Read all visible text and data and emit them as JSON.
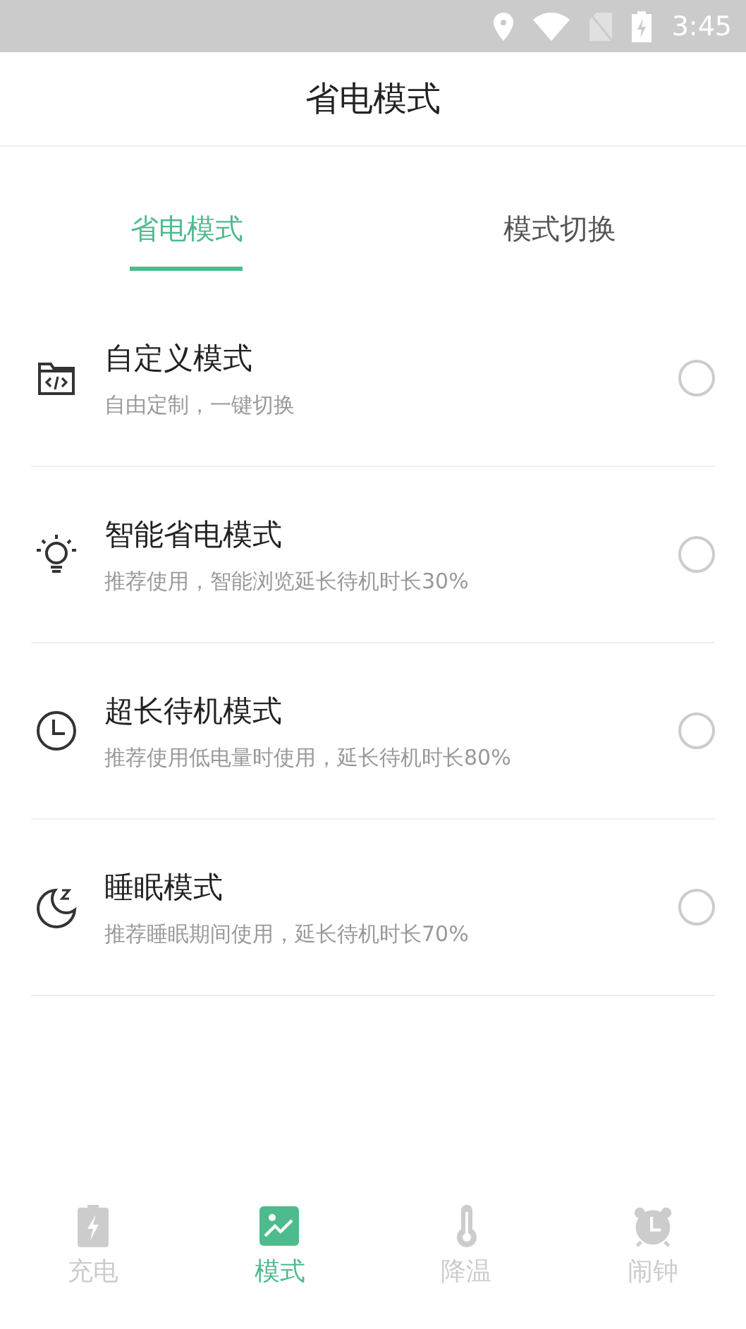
{
  "status_bar": {
    "time": "3:45"
  },
  "header": {
    "title": "省电模式"
  },
  "tabs": [
    {
      "label": "省电模式",
      "selected": true
    },
    {
      "label": "模式切换",
      "selected": false
    }
  ],
  "modes": [
    {
      "kind": "custom",
      "title": "自定义模式",
      "description": "自由定制，一键切换",
      "selected": false
    },
    {
      "kind": "bulb",
      "title": "智能省电模式",
      "description": "推荐使用，智能浏览延长待机时长30%",
      "selected": false
    },
    {
      "kind": "clock",
      "title": "超长待机模式",
      "description": "推荐使用低电量时使用，延长待机时长80%",
      "selected": false
    },
    {
      "kind": "sleep",
      "title": "睡眠模式",
      "description": "推荐睡眠期间使用，延长待机时长70%",
      "selected": false
    }
  ],
  "bottom_nav": [
    {
      "kind": "charge",
      "label": "充电",
      "selected": false
    },
    {
      "kind": "mode",
      "label": "模式",
      "selected": true
    },
    {
      "kind": "temperature",
      "label": "降温",
      "selected": false
    },
    {
      "kind": "alarm",
      "label": "闹钟",
      "selected": false
    }
  ]
}
